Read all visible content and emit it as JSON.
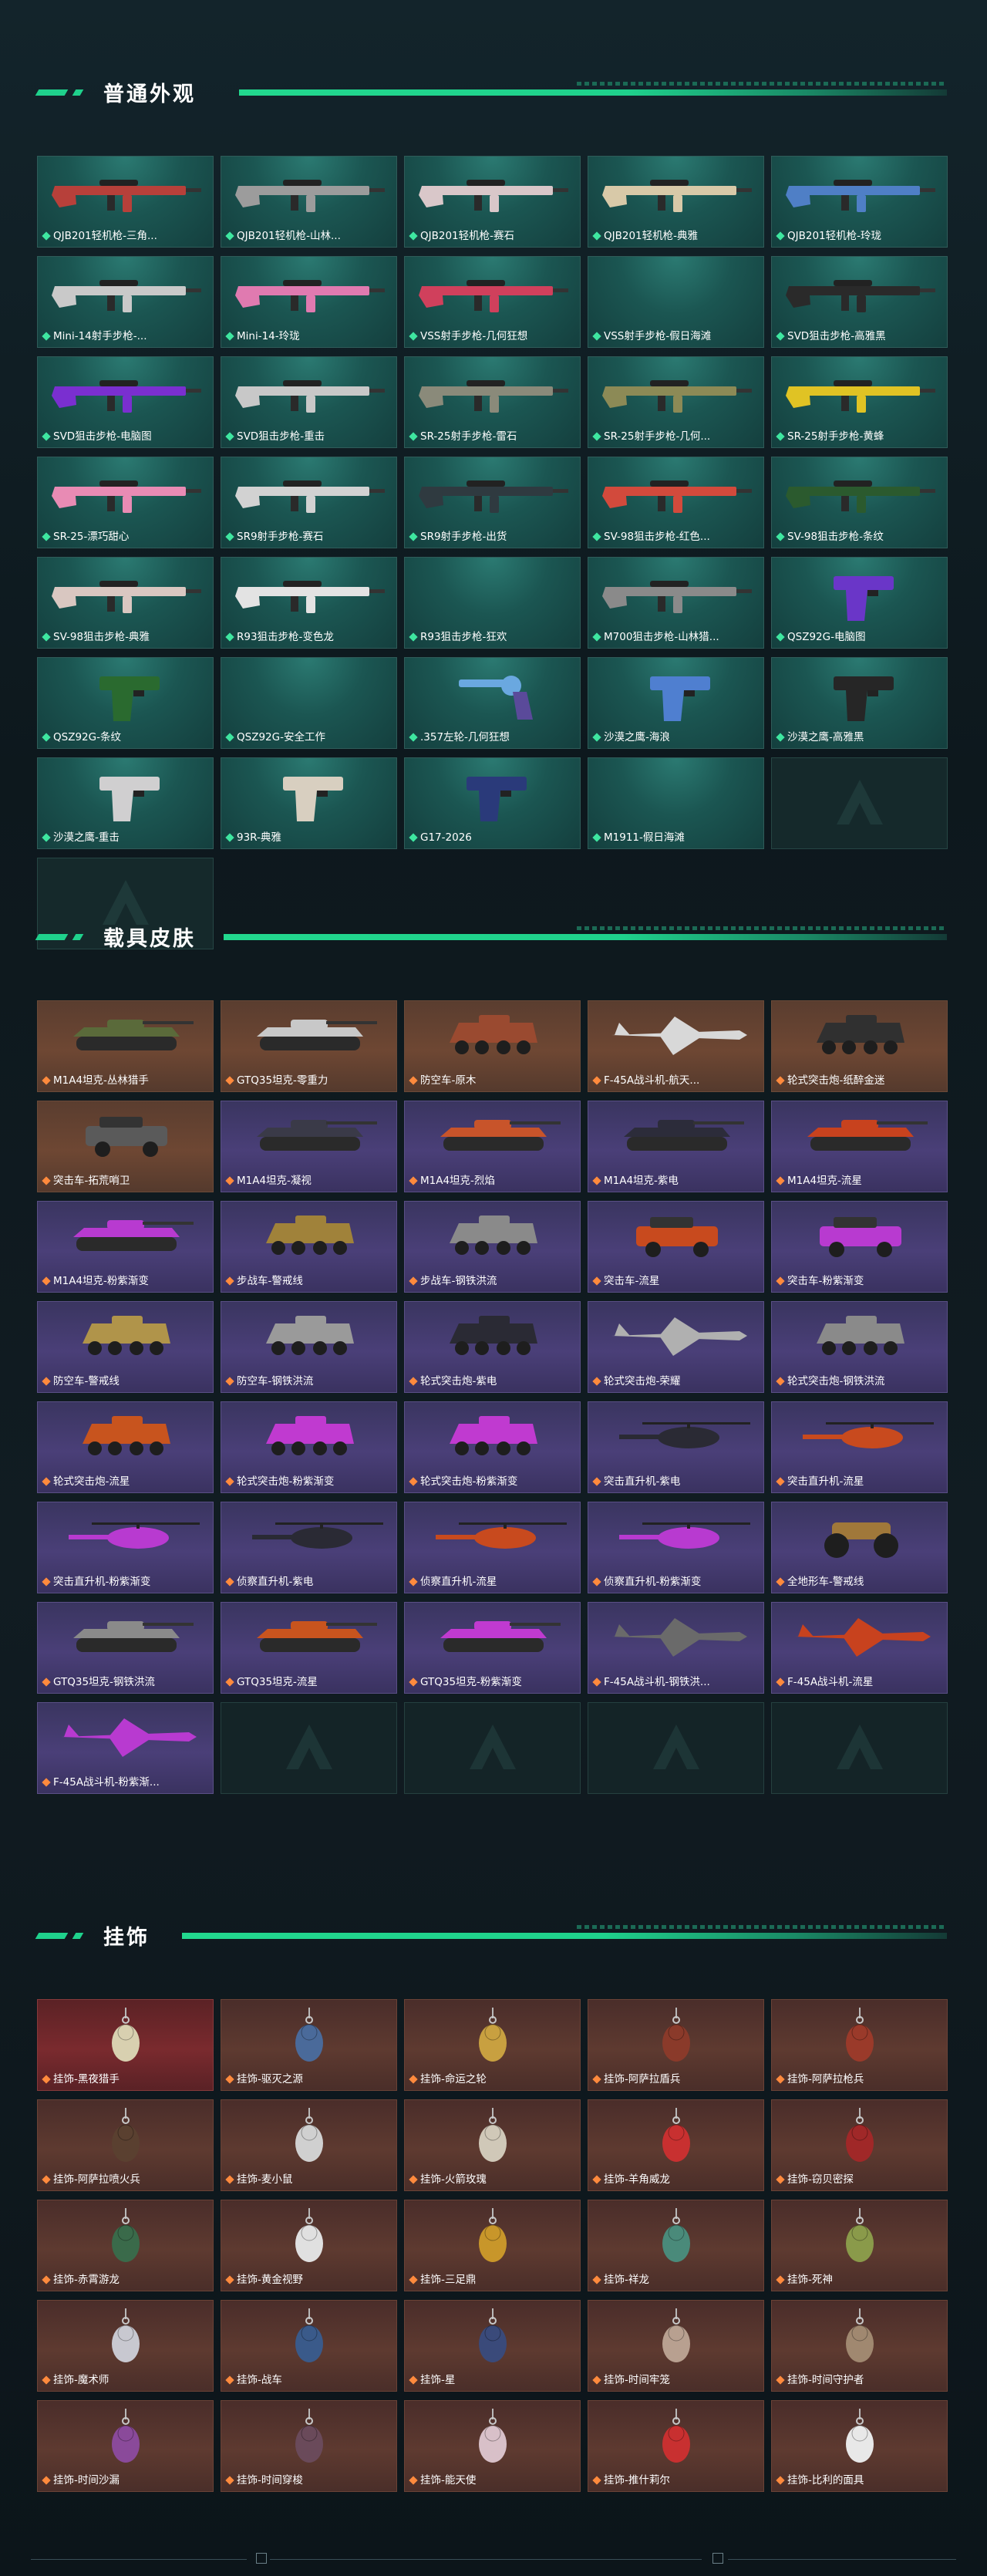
{
  "sections": [
    {
      "title": "普通外观",
      "items": [
        {
          "label": "QJB201轻机枪-三角...",
          "bg": "teal",
          "art": "rifle",
          "color": "#b7403a",
          "rarity": "green"
        },
        {
          "label": "QJB201轻机枪-山林...",
          "bg": "teal",
          "art": "rifle",
          "color": "#9c9c9c",
          "rarity": "green"
        },
        {
          "label": "QJB201轻机枪-赛石",
          "bg": "teal",
          "art": "rifle",
          "color": "#d9c7c9",
          "rarity": "green"
        },
        {
          "label": "QJB201轻机枪-典雅",
          "bg": "teal",
          "art": "rifle",
          "color": "#d8c9a8",
          "rarity": "green"
        },
        {
          "label": "QJB201轻机枪-玲珑",
          "bg": "teal",
          "art": "rifle",
          "color": "#4f7fc6",
          "rarity": "green"
        },
        {
          "label": "Mini-14射手步枪-...",
          "bg": "teal",
          "art": "rifle",
          "color": "#c9c9c9",
          "rarity": "green"
        },
        {
          "label": "Mini-14-玲珑",
          "bg": "teal",
          "art": "rifle",
          "color": "#e07ab0",
          "rarity": "green"
        },
        {
          "label": "VSS射手步枪-几何狂想",
          "bg": "teal",
          "art": "rifle",
          "color": "#d0405c",
          "rarity": "green"
        },
        {
          "label": "VSS射手步枪-假日海滩",
          "bg": "teal",
          "art": "none",
          "color": "#ffffff",
          "rarity": "green"
        },
        {
          "label": "SVD狙击步枪-高雅黑",
          "bg": "teal",
          "art": "rifle",
          "color": "#2a2a2a",
          "rarity": "green"
        },
        {
          "label": "SVD狙击步枪-电脑图",
          "bg": "teal",
          "art": "rifle",
          "color": "#7a2fd0",
          "rarity": "green"
        },
        {
          "label": "SVD狙击步枪-重击",
          "bg": "teal",
          "art": "rifle",
          "color": "#c8c8c8",
          "rarity": "green"
        },
        {
          "label": "SR-25射手步枪-雷石",
          "bg": "teal",
          "art": "rifle",
          "color": "#8a8a7a",
          "rarity": "green"
        },
        {
          "label": "SR-25射手步枪-几何...",
          "bg": "teal",
          "art": "rifle",
          "color": "#8c8a56",
          "rarity": "green"
        },
        {
          "label": "SR-25射手步枪-黄蜂",
          "bg": "teal",
          "art": "rifle",
          "color": "#e0c324",
          "rarity": "green"
        },
        {
          "label": "SR-25-漂巧甜心",
          "bg": "teal",
          "art": "rifle",
          "color": "#e88bb4",
          "rarity": "green"
        },
        {
          "label": "SR9射手步枪-赛石",
          "bg": "teal",
          "art": "rifle",
          "color": "#d2d2d2",
          "rarity": "green"
        },
        {
          "label": "SR9射手步枪-出货",
          "bg": "teal",
          "art": "rifle",
          "color": "#2f3a40",
          "rarity": "green"
        },
        {
          "label": "SV-98狙击步枪-红色...",
          "bg": "teal",
          "art": "rifle",
          "color": "#d24a3c",
          "rarity": "green"
        },
        {
          "label": "SV-98狙击步枪-条纹",
          "bg": "teal",
          "art": "rifle",
          "color": "#2b5a2e",
          "rarity": "green"
        },
        {
          "label": "SV-98狙击步枪-典雅",
          "bg": "teal",
          "art": "rifle",
          "color": "#d9c7c1",
          "rarity": "green"
        },
        {
          "label": "R93狙击步枪-变色龙",
          "bg": "teal",
          "art": "rifle",
          "color": "#e3e3e3",
          "rarity": "green"
        },
        {
          "label": "R93狙击步枪-狂欢",
          "bg": "teal",
          "art": "none",
          "color": "#ffffff",
          "rarity": "green"
        },
        {
          "label": "M700狙击步枪-山林猎...",
          "bg": "teal",
          "art": "rifle",
          "color": "#8a8a8a",
          "rarity": "green"
        },
        {
          "label": "QSZ92G-电脑图",
          "bg": "teal",
          "art": "pistol",
          "color": "#6a36c8",
          "rarity": "green"
        },
        {
          "label": "QSZ92G-条纹",
          "bg": "teal",
          "art": "pistol",
          "color": "#2a6a2f",
          "rarity": "green"
        },
        {
          "label": "QSZ92G-安全工作",
          "bg": "teal",
          "art": "none",
          "color": "#ffffff",
          "rarity": "green"
        },
        {
          "label": ".357左轮-几何狂想",
          "bg": "teal",
          "art": "revolver",
          "color": "#6aa8e0",
          "rarity": "green"
        },
        {
          "label": "沙漠之鹰-海浪",
          "bg": "teal",
          "art": "pistol",
          "color": "#4f7fd0",
          "rarity": "green"
        },
        {
          "label": "沙漠之鹰-高雅黑",
          "bg": "teal",
          "art": "pistol",
          "color": "#262626",
          "rarity": "green"
        },
        {
          "label": "沙漠之鹰-重击",
          "bg": "teal",
          "art": "pistol",
          "color": "#d0cfd0",
          "rarity": "green"
        },
        {
          "label": "93R-典雅",
          "bg": "teal",
          "art": "pistol",
          "color": "#d8cfc0",
          "rarity": "green"
        },
        {
          "label": "G17-2026",
          "bg": "teal",
          "art": "pistol",
          "color": "#2a3a7a",
          "rarity": "green"
        },
        {
          "label": "M1911-假日海滩",
          "bg": "teal",
          "art": "none",
          "color": "#ffffff",
          "rarity": "green"
        },
        {
          "label": "",
          "bg": "empty",
          "art": "logo",
          "color": "#ffffff",
          "rarity": "none"
        },
        {
          "label": "",
          "bg": "empty",
          "art": "logo",
          "color": "#ffffff",
          "rarity": "none"
        }
      ]
    },
    {
      "title": "载具皮肤",
      "items": [
        {
          "label": "M1A4坦克-丛林猎手",
          "bg": "brown",
          "art": "tank",
          "color": "#5a6a3a",
          "rarity": "orange"
        },
        {
          "label": "GTQ35坦克-零重力",
          "bg": "brown",
          "art": "tank",
          "color": "#c8c8c8",
          "rarity": "orange"
        },
        {
          "label": "防空车-原木",
          "bg": "brown",
          "art": "apc",
          "color": "#9a4a30",
          "rarity": "orange"
        },
        {
          "label": "F-45A战斗机-航天...",
          "bg": "brown",
          "art": "jet",
          "color": "#d8d8d8",
          "rarity": "orange"
        },
        {
          "label": "轮式突击炮-纸醉金迷",
          "bg": "brown",
          "art": "apc",
          "color": "#303030",
          "rarity": "orange"
        },
        {
          "label": "突击车-拓荒哨卫",
          "bg": "brown",
          "art": "jeep",
          "color": "#5a5a5a",
          "rarity": "orange"
        },
        {
          "label": "M1A4坦克-凝视",
          "bg": "purple",
          "art": "tank",
          "color": "#3a3a48",
          "rarity": "orange"
        },
        {
          "label": "M1A4坦克-烈焰",
          "bg": "purple",
          "art": "tank",
          "color": "#c8542a",
          "rarity": "orange"
        },
        {
          "label": "M1A4坦克-紫电",
          "bg": "purple",
          "art": "tank",
          "color": "#2c2c3a",
          "rarity": "orange"
        },
        {
          "label": "M1A4坦克-流星",
          "bg": "purple",
          "art": "tank",
          "color": "#c8421e",
          "rarity": "orange"
        },
        {
          "label": "M1A4坦克-粉紫渐变",
          "bg": "purple",
          "art": "tank",
          "color": "#b83ad0",
          "rarity": "orange"
        },
        {
          "label": "步战车-警戒线",
          "bg": "purple",
          "art": "apc",
          "color": "#a0823a",
          "rarity": "orange"
        },
        {
          "label": "步战车-钢铁洪流",
          "bg": "purple",
          "art": "apc",
          "color": "#8a8a8a",
          "rarity": "orange"
        },
        {
          "label": "突击车-流星",
          "bg": "purple",
          "art": "jeep",
          "color": "#c84a1e",
          "rarity": "orange"
        },
        {
          "label": "突击车-粉紫渐变",
          "bg": "purple",
          "art": "jeep",
          "color": "#b83ad0",
          "rarity": "orange"
        },
        {
          "label": "防空车-警戒线",
          "bg": "purple",
          "art": "apc",
          "color": "#b0944a",
          "rarity": "orange"
        },
        {
          "label": "防空车-钢铁洪流",
          "bg": "purple",
          "art": "apc",
          "color": "#9a9a9a",
          "rarity": "orange"
        },
        {
          "label": "轮式突击炮-紫电",
          "bg": "purple",
          "art": "apc",
          "color": "#2a2a34",
          "rarity": "orange"
        },
        {
          "label": "轮式突击炮-荣耀",
          "bg": "purple",
          "art": "jet",
          "color": "#b0b0b0",
          "rarity": "orange"
        },
        {
          "label": "轮式突击炮-钢铁洪流",
          "bg": "purple",
          "art": "apc",
          "color": "#8a8a8a",
          "rarity": "orange"
        },
        {
          "label": "轮式突击炮-流星",
          "bg": "purple",
          "art": "apc",
          "color": "#c8541e",
          "rarity": "orange"
        },
        {
          "label": "轮式突击炮-粉紫渐变",
          "bg": "purple",
          "art": "apc",
          "color": "#c03ad0",
          "rarity": "orange"
        },
        {
          "label": "轮式突击炮-粉紫渐变",
          "bg": "purple",
          "art": "apc",
          "color": "#c03ad0",
          "rarity": "orange"
        },
        {
          "label": "突击直升机-紫电",
          "bg": "purple",
          "art": "heli",
          "color": "#2a2a34",
          "rarity": "orange"
        },
        {
          "label": "突击直升机-流星",
          "bg": "purple",
          "art": "heli",
          "color": "#c84a1e",
          "rarity": "orange"
        },
        {
          "label": "突击直升机-粉紫渐变",
          "bg": "purple",
          "art": "heli",
          "color": "#b83ad0",
          "rarity": "orange"
        },
        {
          "label": "侦察直升机-紫电",
          "bg": "purple",
          "art": "heli",
          "color": "#2a2a34",
          "rarity": "orange"
        },
        {
          "label": "侦察直升机-流星",
          "bg": "purple",
          "art": "heli",
          "color": "#c84a1e",
          "rarity": "orange"
        },
        {
          "label": "侦察直升机-粉紫渐变",
          "bg": "purple",
          "art": "heli",
          "color": "#b83ad0",
          "rarity": "orange"
        },
        {
          "label": "全地形车-警戒线",
          "bg": "purple",
          "art": "atv",
          "color": "#a0783a",
          "rarity": "orange"
        },
        {
          "label": "GTQ35坦克-钢铁洪流",
          "bg": "purple",
          "art": "tank",
          "color": "#8a8a8a",
          "rarity": "orange"
        },
        {
          "label": "GTQ35坦克-流星",
          "bg": "purple",
          "art": "tank",
          "color": "#c8541e",
          "rarity": "orange"
        },
        {
          "label": "GTQ35坦克-粉紫渐变",
          "bg": "purple",
          "art": "tank",
          "color": "#c03ad0",
          "rarity": "orange"
        },
        {
          "label": "F-45A战斗机-钢铁洪...",
          "bg": "purple",
          "art": "jet",
          "color": "#6a6a6a",
          "rarity": "orange"
        },
        {
          "label": "F-45A战斗机-流星",
          "bg": "purple",
          "art": "jet",
          "color": "#c8421e",
          "rarity": "orange"
        },
        {
          "label": "F-45A战斗机-粉紫渐...",
          "bg": "purple",
          "art": "jet",
          "color": "#b83ad0",
          "rarity": "orange"
        },
        {
          "label": "",
          "bg": "empty2",
          "art": "logo",
          "color": "#ffffff",
          "rarity": "none"
        },
        {
          "label": "",
          "bg": "empty2",
          "art": "logo",
          "color": "#ffffff",
          "rarity": "none"
        },
        {
          "label": "",
          "bg": "empty2",
          "art": "logo",
          "color": "#ffffff",
          "rarity": "none"
        },
        {
          "label": "",
          "bg": "empty2",
          "art": "logo",
          "color": "#ffffff",
          "rarity": "none"
        }
      ]
    },
    {
      "title": "挂饰",
      "items": [
        {
          "label": "挂饰-黑夜猎手",
          "bg": "red",
          "art": "charm",
          "color": "#d8d0b0",
          "rarity": "orange"
        },
        {
          "label": "挂饰-驱灭之源",
          "bg": "rust",
          "art": "charm",
          "color": "#4a6a9a",
          "rarity": "orange"
        },
        {
          "label": "挂饰-命运之轮",
          "bg": "rust",
          "art": "charm",
          "color": "#c8a040",
          "rarity": "orange"
        },
        {
          "label": "挂饰-阿萨拉盾兵",
          "bg": "rust",
          "art": "charm",
          "color": "#8a3a2a",
          "rarity": "orange"
        },
        {
          "label": "挂饰-阿萨拉枪兵",
          "bg": "rust",
          "art": "charm",
          "color": "#9a3a2a",
          "rarity": "orange"
        },
        {
          "label": "挂饰-阿萨拉喷火兵",
          "bg": "rust",
          "art": "charm",
          "color": "#5a4030",
          "rarity": "orange"
        },
        {
          "label": "挂饰-麦小鼠",
          "bg": "rust",
          "art": "charm",
          "color": "#d0d0d0",
          "rarity": "orange"
        },
        {
          "label": "挂饰-火箭玫瑰",
          "bg": "rust",
          "art": "charm",
          "color": "#d0c8b8",
          "rarity": "orange"
        },
        {
          "label": "挂饰-羊角威龙",
          "bg": "rust",
          "art": "charm",
          "color": "#c83030",
          "rarity": "orange"
        },
        {
          "label": "挂饰-窃贝密探",
          "bg": "rust",
          "art": "charm",
          "color": "#a02828",
          "rarity": "orange"
        },
        {
          "label": "挂饰-赤霄游龙",
          "bg": "rust",
          "art": "charm",
          "color": "#3a6a4a",
          "rarity": "orange"
        },
        {
          "label": "挂饰-黄金视野",
          "bg": "rust",
          "art": "charm",
          "color": "#e0e0e0",
          "rarity": "orange"
        },
        {
          "label": "挂饰-三足鼎",
          "bg": "rust",
          "art": "charm",
          "color": "#c8962a",
          "rarity": "orange"
        },
        {
          "label": "挂饰-祥龙",
          "bg": "rust",
          "art": "charm",
          "color": "#4a8a7a",
          "rarity": "orange"
        },
        {
          "label": "挂饰-死神",
          "bg": "rust",
          "art": "charm",
          "color": "#8a9a4a",
          "rarity": "orange"
        },
        {
          "label": "挂饰-魔术师",
          "bg": "rust",
          "art": "charm",
          "color": "#c8c8d0",
          "rarity": "orange"
        },
        {
          "label": "挂饰-战车",
          "bg": "rust",
          "art": "charm",
          "color": "#3a5a8a",
          "rarity": "orange"
        },
        {
          "label": "挂饰-星",
          "bg": "rust",
          "art": "charm",
          "color": "#3a4a7a",
          "rarity": "orange"
        },
        {
          "label": "挂饰-时间牢笼",
          "bg": "rust",
          "art": "charm",
          "color": "#b8a090",
          "rarity": "orange"
        },
        {
          "label": "挂饰-时间守护者",
          "bg": "rust",
          "art": "charm",
          "color": "#a08870",
          "rarity": "orange"
        },
        {
          "label": "挂饰-时间沙漏",
          "bg": "rust",
          "art": "charm",
          "color": "#8a4a9a",
          "rarity": "orange"
        },
        {
          "label": "挂饰-时间穿梭",
          "bg": "rust",
          "art": "charm",
          "color": "#6a4a5a",
          "rarity": "orange"
        },
        {
          "label": "挂饰-能天使",
          "bg": "rust",
          "art": "charm",
          "color": "#d8c0c8",
          "rarity": "orange"
        },
        {
          "label": "挂饰-推什莉尔",
          "bg": "rust",
          "art": "charm",
          "color": "#c83030",
          "rarity": "orange"
        },
        {
          "label": "挂饰-比利的面具",
          "bg": "rust",
          "art": "charm",
          "color": "#e8e8e8",
          "rarity": "orange"
        }
      ]
    }
  ]
}
